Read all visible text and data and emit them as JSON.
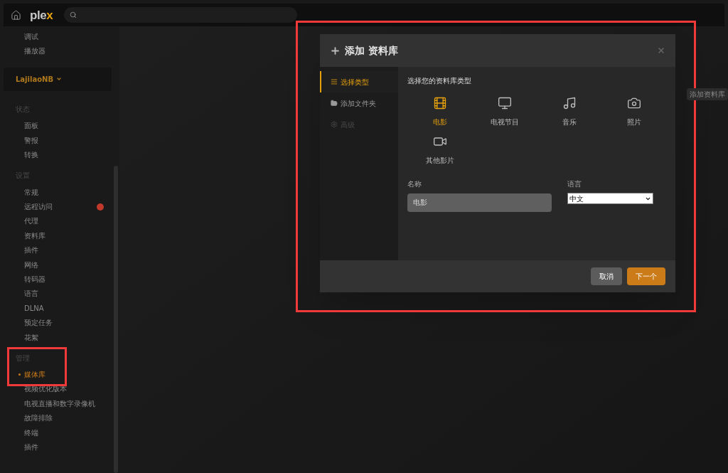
{
  "topbar": {
    "logo": "plex"
  },
  "sidebar": {
    "groups": [
      {
        "items": [
          {
            "label": "调试",
            "selected": false,
            "alert": false
          },
          {
            "label": "播放器",
            "selected": false,
            "alert": false
          }
        ]
      },
      {
        "server": "LajilaoNB"
      },
      {
        "heading": "状态",
        "items": [
          {
            "label": "面板",
            "selected": false,
            "alert": false
          },
          {
            "label": "警报",
            "selected": false,
            "alert": false
          },
          {
            "label": "转换",
            "selected": false,
            "alert": false
          }
        ]
      },
      {
        "heading": "设置",
        "items": [
          {
            "label": "常规",
            "selected": false,
            "alert": false
          },
          {
            "label": "远程访问",
            "selected": false,
            "alert": true
          },
          {
            "label": "代理",
            "selected": false,
            "alert": false
          },
          {
            "label": "资料库",
            "selected": false,
            "alert": false
          },
          {
            "label": "插件",
            "selected": false,
            "alert": false
          },
          {
            "label": "网络",
            "selected": false,
            "alert": false
          },
          {
            "label": "转码器",
            "selected": false,
            "alert": false
          },
          {
            "label": "语言",
            "selected": false,
            "alert": false
          },
          {
            "label": "DLNA",
            "selected": false,
            "alert": false
          },
          {
            "label": "预定任务",
            "selected": false,
            "alert": false
          },
          {
            "label": "花絮",
            "selected": false,
            "alert": false
          }
        ]
      },
      {
        "heading": "管理",
        "items": [
          {
            "label": "媒体库",
            "selected": true,
            "alert": false
          },
          {
            "label": "视频优化版本",
            "selected": false,
            "alert": false
          },
          {
            "label": "电视直播和数字录像机",
            "selected": false,
            "alert": false
          },
          {
            "label": "故障排除",
            "selected": false,
            "alert": false
          },
          {
            "label": "终端",
            "selected": false,
            "alert": false
          },
          {
            "label": "插件",
            "selected": false,
            "alert": false
          }
        ]
      }
    ]
  },
  "main": {
    "add_library_button": "添加资料库"
  },
  "dialog": {
    "title": "添加 资料库",
    "steps": [
      {
        "label": "选择类型",
        "selected": true,
        "disabled": false
      },
      {
        "label": "添加文件夹",
        "selected": false,
        "disabled": false
      },
      {
        "label": "高级",
        "selected": false,
        "disabled": true
      }
    ],
    "prompt": "选择您的资料库类型",
    "types": [
      {
        "label": "电影",
        "selected": true
      },
      {
        "label": "电视节目",
        "selected": false
      },
      {
        "label": "音乐",
        "selected": false
      },
      {
        "label": "照片",
        "selected": false
      },
      {
        "label": "其他影片",
        "selected": false
      }
    ],
    "name_label": "名称",
    "name_value": "电影",
    "language_label": "语言",
    "language_value": "中文",
    "buttons": [
      {
        "label": "取消",
        "kind": "secondary"
      },
      {
        "label": "下一个",
        "kind": "primary"
      }
    ]
  }
}
